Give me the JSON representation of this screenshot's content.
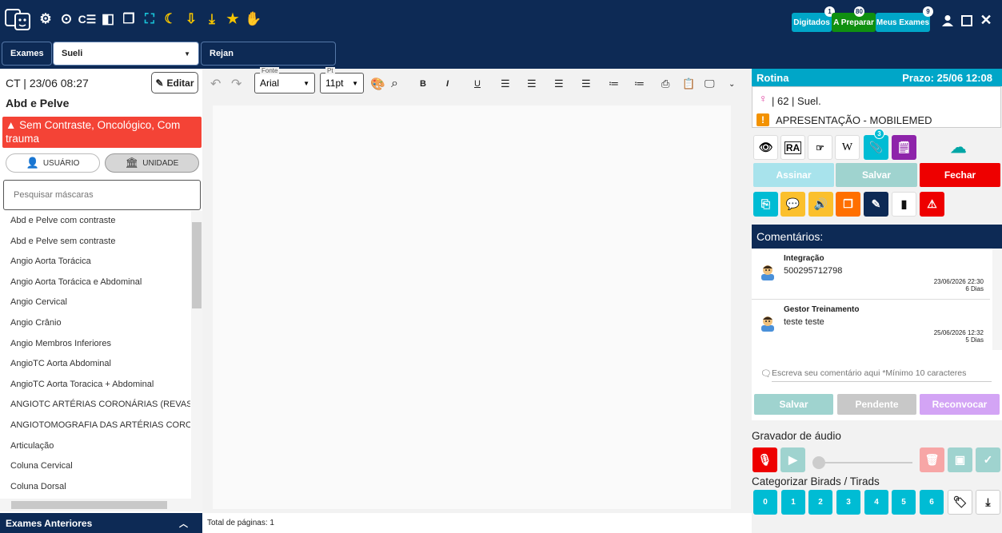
{
  "topbar": {
    "badges": [
      {
        "label": "Digitados",
        "count": "1",
        "color": "#00a6c8"
      },
      {
        "label": "A Preparar",
        "count": "80",
        "color": "#109010"
      },
      {
        "label": "Meus Exames",
        "count": "9",
        "color": "#00a6c8"
      }
    ]
  },
  "tabs": {
    "exames": "Exames",
    "user": "Sueli",
    "rejan": "Rejan"
  },
  "left": {
    "exam_header": "CT | 23/06 08:27",
    "edit_label": "Editar",
    "exam_title": "Abd e Pelve",
    "alert": "Sem Contraste, Oncológico, Com trauma",
    "usuario": "USUÁRIO",
    "unidade": "UNIDADE",
    "search_placeholder": "Pesquisar máscaras",
    "masks": [
      "Abd e Pelve com contraste",
      "Abd e Pelve sem contraste",
      "Angio Aorta Torácica",
      "Angio Aorta Torácica e Abdominal",
      "Angio Cervical",
      "Angio Crânio",
      "Angio Membros Inferiores",
      "AngioTC Aorta Abdominal",
      "AngioTC Aorta Toracica + Abdominal",
      "ANGIOTC ARTÉRIAS CORONÁRIAS (REVASC)",
      "ANGIOTOMOGRAFIA DAS ARTÉRIAS CORONÁRI",
      "Articulação",
      "Coluna Cervical",
      "Coluna Dorsal"
    ],
    "exames_anteriores": "Exames Anteriores"
  },
  "editor": {
    "font_label": "Fonte",
    "font_value": "Arial",
    "pt_label": "Pt",
    "pt_value": "11pt",
    "footer": "Total de páginas: 1"
  },
  "right": {
    "rotina": "Rotina",
    "prazo": "Prazo: 25/06 12:08",
    "patient": "| 62 | Suel.",
    "apresentacao": "APRESENTAÇÃO - MOBILEMED",
    "ra_label": "RA",
    "wiki_label": "W",
    "attach_count": "3",
    "assinar": "Assinar",
    "salvar": "Salvar",
    "fechar": "Fechar",
    "comentarios_title": "Comentários:",
    "comments": [
      {
        "author": "Integração",
        "text": "500295712798",
        "date": "23/06/2026 22:30",
        "ago": "6 Dias"
      },
      {
        "author": "Gestor Treinamento",
        "text": "teste teste",
        "date": "25/06/2026 12:32",
        "ago": "5 Dias"
      }
    ],
    "comment_placeholder": "Escreva seu comentário aqui *Mínimo 10 caracteres",
    "c_salvar": "Salvar",
    "c_pendente": "Pendente",
    "c_reconvocar": "Reconvocar",
    "gravador": "Gravador de áudio",
    "birads_title": "Categorizar Birads / Tirads",
    "birads": [
      "0",
      "1",
      "2",
      "3",
      "4",
      "5",
      "6"
    ]
  }
}
